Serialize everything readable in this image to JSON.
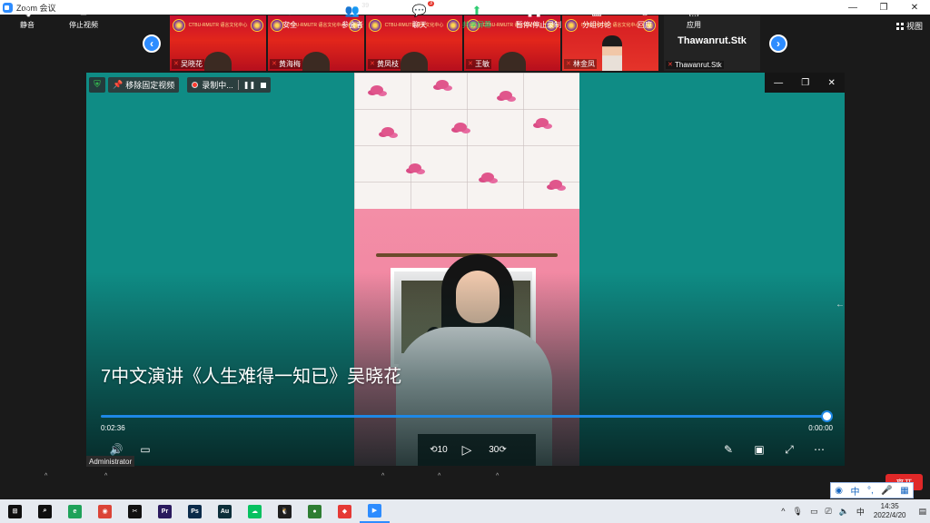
{
  "window": {
    "title": "Zoom 会议",
    "minimize": "—",
    "restore": "❐",
    "close": "✕"
  },
  "participants": {
    "prev_icon": "chevron-left-icon",
    "next_icon": "chevron-right-icon",
    "prev": "‹",
    "next": "›",
    "banner_text": "CTBU-RMUTR 语言文化中心",
    "items": [
      {
        "name": "吴晓花",
        "muted": true
      },
      {
        "name": "黄海梅",
        "muted": true
      },
      {
        "name": "黄凤枝",
        "muted": true
      },
      {
        "name": "王敏",
        "muted": true
      },
      {
        "name": "林金凤",
        "muted": true
      }
    ],
    "self": {
      "big_name": "Thawanrut.Stk",
      "name": "Thawanrut.Stk",
      "muted": true
    },
    "view_label": "视图"
  },
  "share": {
    "unpin_label": "移除固定视频",
    "recording_label": "录制中...",
    "pause_glyph": "❚❚",
    "mic_off_glyph": "✕",
    "caption": "7中文演讲《人生难得一知已》吴晓花",
    "progress": 1.0,
    "time_elapsed": "0:02:36",
    "time_remaining": "0:00:00",
    "video_window": {
      "minimize": "—",
      "restore": "❐",
      "close": "✕"
    },
    "controls": {
      "volume": "🔊",
      "subtitles": "▭",
      "rewind": "⟲10",
      "play": "▷",
      "forward": "30⟳",
      "edit": "✎",
      "pip": "▣",
      "fullscreen": "⤢",
      "more": "⋯"
    },
    "host_label": "Administrator",
    "side_arrow": "←"
  },
  "toolbar": {
    "mute": {
      "label": "静音",
      "icon": "🎙"
    },
    "video": {
      "label": "停止视频",
      "icon": "■"
    },
    "security": {
      "label": "安全",
      "icon": "⛨"
    },
    "participants": {
      "label": "参会者",
      "count": "39",
      "icon": "👥"
    },
    "chat": {
      "label": "聊天",
      "badge": "3",
      "icon": "💬"
    },
    "share": {
      "label": "共享屏幕",
      "icon": "⬆"
    },
    "record": {
      "label": "暂停/停止录制",
      "icon": "❚❚ ■"
    },
    "breakout": {
      "label": "分组讨论",
      "icon": "▦"
    },
    "reactions": {
      "label": "回应",
      "icon": "☺"
    },
    "apps": {
      "label": "应用",
      "icon": "⬚"
    },
    "caret": "^",
    "end_label": "离开"
  },
  "ime": {
    "logo": "◉",
    "lang": "中",
    "punct": "°,",
    "mic": "🎤",
    "grid": "▦"
  },
  "taskbar": {
    "apps": [
      {
        "name": "windows-start",
        "glyph": "⊞",
        "color": "#0f0f0f"
      },
      {
        "name": "search",
        "glyph": "⌕",
        "color": "#0f0f0f"
      },
      {
        "name": "edge",
        "glyph": "e",
        "color": "#1fa25a"
      },
      {
        "name": "chrome",
        "glyph": "◉",
        "color": "#db4437"
      },
      {
        "name": "capcut",
        "glyph": "✂",
        "color": "#111111"
      },
      {
        "name": "premiere",
        "glyph": "Pr",
        "color": "#2a1a5e"
      },
      {
        "name": "photoshop",
        "glyph": "Ps",
        "color": "#0b2b4a"
      },
      {
        "name": "audition",
        "glyph": "Au",
        "color": "#0d2f3a"
      },
      {
        "name": "wechat",
        "glyph": "☁",
        "color": "#07c160"
      },
      {
        "name": "qq",
        "glyph": "🐧",
        "color": "#1e1e1e"
      },
      {
        "name": "obs",
        "glyph": "●",
        "color": "#2e7d32"
      },
      {
        "name": "app-red",
        "glyph": "◆",
        "color": "#e53935"
      },
      {
        "name": "zoom",
        "glyph": "▶",
        "color": "#2d8cff"
      }
    ],
    "time": "14:35",
    "date": "2022/4/20",
    "tray_up": "^",
    "tray_mic": "🎙",
    "tray_keyboard": "▭",
    "tray_monitor": "⎚",
    "tray_volume": "🔈",
    "tray_ime": "中",
    "tray_notify": "▤"
  }
}
